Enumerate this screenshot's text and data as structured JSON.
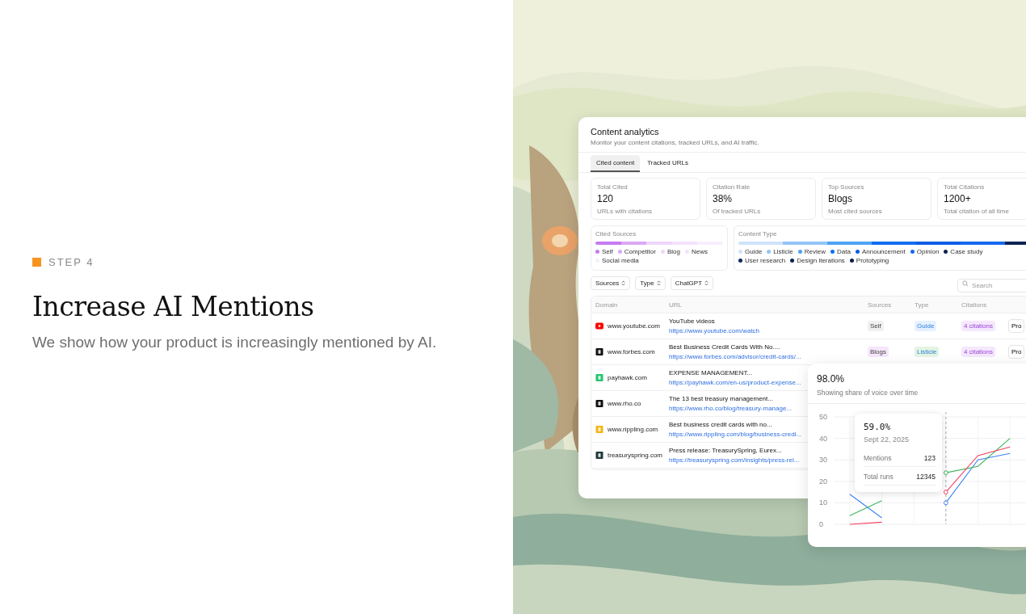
{
  "step": {
    "label": "STEP 4"
  },
  "headline": "Increase AI Mentions",
  "description": "We show how your product is increasingly mentioned by AI.",
  "analytics": {
    "title": "Content analytics",
    "subtitle": "Monitor your content citations, tracked URLs, and AI traffic.",
    "tabs": [
      {
        "label": "Cited content",
        "selected": true
      },
      {
        "label": "Tracked URLs",
        "selected": false
      }
    ],
    "stats": [
      {
        "label": "Total Cited",
        "value": "120",
        "note": "URLs with citations"
      },
      {
        "label": "Citation Rate",
        "value": "38%",
        "note": "Of tracked URLs"
      },
      {
        "label": "Top Sources",
        "value": "Blogs",
        "note": "Most cited sources"
      },
      {
        "label": "Total Citations",
        "value": "1200+",
        "note": "Total citation of all time"
      }
    ],
    "cited_sources": {
      "title": "Cited Sources",
      "items": [
        {
          "label": "Self",
          "color": "#c57af0"
        },
        {
          "label": "Competitor",
          "color": "#dba8f5"
        },
        {
          "label": "Blog",
          "color": "#efd6fb"
        },
        {
          "label": "News",
          "color": "#f4e2fb"
        },
        {
          "label": "Social media",
          "color": "#f8eefd"
        }
      ]
    },
    "content_type": {
      "title": "Content Type",
      "items": [
        {
          "label": "Guide",
          "color": "#cfe3fb"
        },
        {
          "label": "Listicle",
          "color": "#93c5f7"
        },
        {
          "label": "Review",
          "color": "#4da3f5"
        },
        {
          "label": "Data",
          "color": "#0f6ef0"
        },
        {
          "label": "Announcement",
          "color": "#0a5ce6"
        },
        {
          "label": "Opinion",
          "color": "#1669f0"
        },
        {
          "label": "Case study",
          "color": "#0c2552"
        },
        {
          "label": "User research",
          "color": "#0d2a5e"
        },
        {
          "label": "Design iterations",
          "color": "#0c2450"
        },
        {
          "label": "Prototyping",
          "color": "#0a1f4a"
        }
      ]
    },
    "filters": [
      "Sources",
      "Type",
      "ChatGPT"
    ],
    "search": {
      "placeholder": "Search"
    },
    "table": {
      "columns": [
        "Domain",
        "URL",
        "Sources",
        "Type",
        "Citations"
      ],
      "rows": [
        {
          "domain": "www.youtube.com",
          "logo": {
            "kind": "play",
            "color": "#ff0000"
          },
          "title": "YouTube videos",
          "url": "https://www.youtube.com/watch",
          "source": {
            "label": "Self",
            "color": "#f0f0f0"
          },
          "type": {
            "label": "Guide",
            "color": "#e6f1ff"
          },
          "citations": "4 citations",
          "action": "Pro"
        },
        {
          "domain": "www.forbes.com",
          "logo": {
            "kind": "square",
            "color": "#111111"
          },
          "title": "Best Business Credit Cards With No....",
          "url": "https://www.forbes.com/advisor/credit-cards/...",
          "source": {
            "label": "Blogs",
            "color": "#f6e6fb"
          },
          "type": {
            "label": "Listicle",
            "color": "#e3f5e3"
          },
          "citations": "4 citations",
          "action": "Pro"
        },
        {
          "domain": "payhawk.com",
          "logo": {
            "kind": "square",
            "color": "#22c56e"
          },
          "title": "EXPENSE MANAGEMENT...",
          "url": "https://payhawk.com/en-us/product-expense..."
        },
        {
          "domain": "www.rho.co",
          "logo": {
            "kind": "square",
            "color": "#111111"
          },
          "title": "The 13 best treasury management...",
          "url": "https://www.rho.co/blog/treasury-manage..."
        },
        {
          "domain": "www.rippling.com",
          "logo": {
            "kind": "square",
            "color": "#f5b516"
          },
          "title": "Best business credit cards with no...",
          "url": "https://www.rippling.com/blog/business-credi..."
        },
        {
          "domain": "treasuryspring.com",
          "logo": {
            "kind": "square",
            "color": "#1f3a3a"
          },
          "title": "Press release: TreasurySpring, Eurex...",
          "url": "https://treasuryspring.com/insights/press-rel..."
        }
      ]
    }
  },
  "voice": {
    "value": "98.0%",
    "subtitle": "Showing share of voice over time",
    "chart_data": {
      "type": "line",
      "ylim": [
        0,
        50
      ],
      "yticks": [
        0,
        10,
        20,
        30,
        40,
        50
      ],
      "grid": true,
      "series": [
        {
          "color": "#3b82f6",
          "values": [
            14,
            3,
            null,
            10,
            30,
            33
          ]
        },
        {
          "color": "#3cb55a",
          "values": [
            4,
            11,
            null,
            24,
            27,
            40
          ]
        },
        {
          "color": "#f43f5e",
          "values": [
            0,
            1,
            null,
            15,
            32,
            36
          ]
        }
      ]
    },
    "tooltip": {
      "value": "59.0%",
      "date": "Sept 22, 2025",
      "rows": [
        {
          "label": "Mentions",
          "value": "123"
        },
        {
          "label": "Total runs",
          "value": "12345"
        }
      ]
    }
  }
}
